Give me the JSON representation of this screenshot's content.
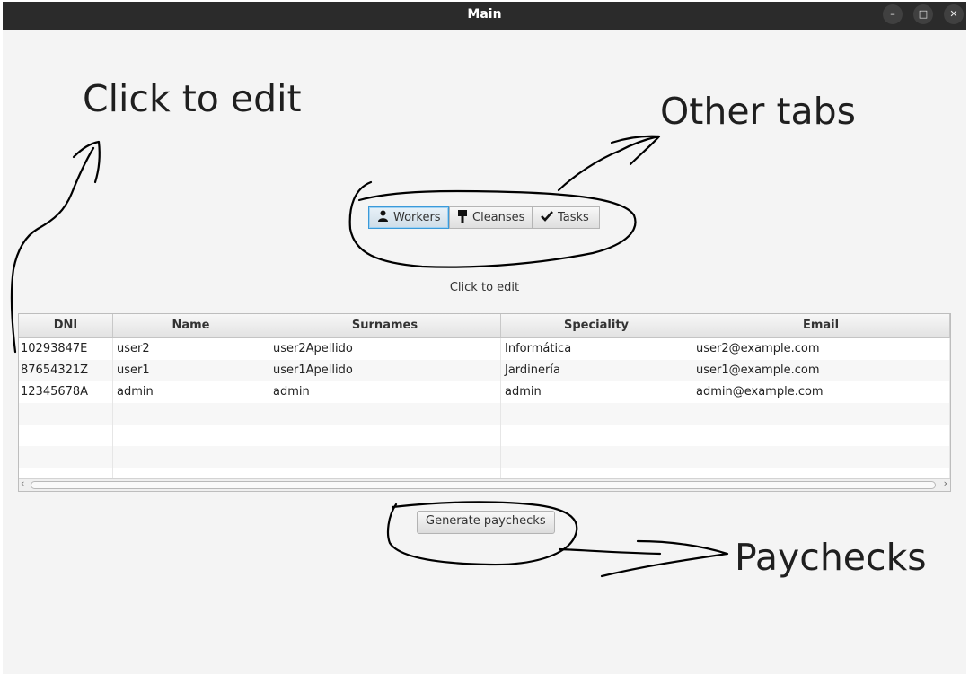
{
  "window": {
    "title": "Main",
    "controls": [
      "minimize",
      "maximize",
      "close"
    ]
  },
  "annotations": {
    "click_to_edit": "Click to edit",
    "other_tabs": "Other tabs",
    "paychecks": "Paychecks"
  },
  "tabs": [
    {
      "label": "Workers",
      "icon": "user-icon",
      "active": true
    },
    {
      "label": "Cleanses",
      "icon": "brush-icon",
      "active": false
    },
    {
      "label": "Tasks",
      "icon": "checkmark-icon",
      "active": false
    }
  ],
  "hint": "Click to edit",
  "table": {
    "columns": [
      "DNI",
      "Name",
      "Surnames",
      "Speciality",
      "Email"
    ],
    "rows": [
      [
        "10293847E",
        "user2",
        "user2Apellido",
        "Informática",
        "user2@example.com"
      ],
      [
        "87654321Z",
        "user1",
        "user1Apellido",
        "Jardinería",
        "user1@example.com"
      ],
      [
        "12345678A",
        "admin",
        "admin",
        "admin",
        "admin@example.com"
      ]
    ]
  },
  "actions": {
    "generate_paychecks": "Generate paychecks"
  },
  "colors": {
    "titlebar": "#2b2b2b",
    "active_tab_border": "#3b9ad9",
    "ink": "#000000"
  }
}
